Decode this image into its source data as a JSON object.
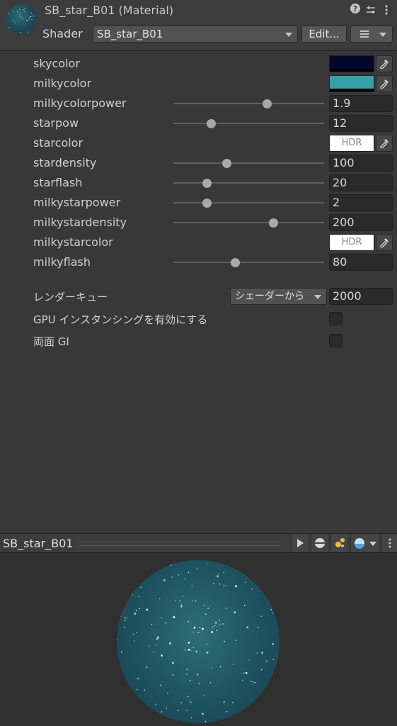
{
  "header": {
    "title": "SB_star_B01 (Material)",
    "shader_label": "Shader",
    "shader_value": "SB_star_B01",
    "edit_label": "Edit...",
    "help_icon": "help-icon",
    "presets_icon": "sliders-icon",
    "menu_icon": "kebab-menu-icon"
  },
  "properties": [
    {
      "label": "skycolor",
      "type": "color",
      "color": "#00082e"
    },
    {
      "label": "milkycolor",
      "type": "color",
      "color": "#3aa0a8"
    },
    {
      "label": "milkycolorpower",
      "type": "slider",
      "value": "1.9",
      "fraction": 0.62
    },
    {
      "label": "starpow",
      "type": "slider",
      "value": "12",
      "fraction": 0.25
    },
    {
      "label": "starcolor",
      "type": "hdr",
      "hdr_text": "HDR"
    },
    {
      "label": "stardensity",
      "type": "slider",
      "value": "100",
      "fraction": 0.35
    },
    {
      "label": "starflash",
      "type": "slider",
      "value": "20",
      "fraction": 0.22
    },
    {
      "label": "milkystarpower",
      "type": "slider",
      "value": "2",
      "fraction": 0.22
    },
    {
      "label": "milkystardensity",
      "type": "slider",
      "value": "200",
      "fraction": 0.66
    },
    {
      "label": "milkystarcolor",
      "type": "hdr",
      "hdr_text": "HDR"
    },
    {
      "label": "milkyflash",
      "type": "slider",
      "value": "80",
      "fraction": 0.41
    }
  ],
  "render_queue": {
    "label": "レンダーキュー",
    "dropdown_value": "シェーダーから",
    "value": "2000"
  },
  "gpu_instancing": {
    "label": "GPU インスタンシングを有効にする",
    "checked": false
  },
  "double_sided_gi": {
    "label": "両面 GI",
    "checked": false
  },
  "preview": {
    "title": "SB_star_B01",
    "buttons": [
      "play-icon",
      "sphere-shape-icon",
      "light-icon",
      "background-sphere-icon",
      "kebab-menu-icon"
    ]
  },
  "colors": {
    "panel": "#383838",
    "sphere": "#1f5462"
  }
}
